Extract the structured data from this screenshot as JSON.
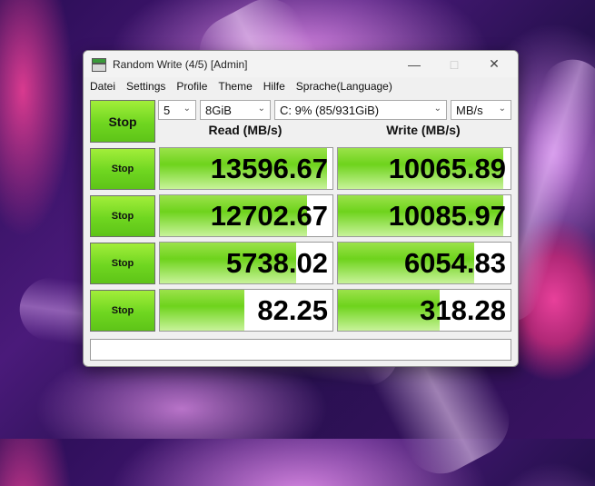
{
  "window": {
    "title": "Random Write (4/5) [Admin]",
    "accent": "#6fd620"
  },
  "menu": [
    "Datei",
    "Settings",
    "Profile",
    "Theme",
    "Hilfe",
    "Sprache(Language)"
  ],
  "controls": {
    "main_button": "Stop",
    "count": "5",
    "size": "8GiB",
    "drive": "C: 9% (85/931GiB)",
    "unit": "MB/s"
  },
  "headers": {
    "read": "Read (MB/s)",
    "write": "Write (MB/s)"
  },
  "rows": [
    {
      "button": "Stop",
      "read": "13596.67",
      "read_fill": 0.97,
      "write": "10065.89",
      "write_fill": 0.96
    },
    {
      "button": "Stop",
      "read": "12702.67",
      "read_fill": 0.85,
      "write": "10085.97",
      "write_fill": 0.96
    },
    {
      "button": "Stop",
      "read": "5738.02",
      "read_fill": 0.79,
      "write": "6054.83",
      "write_fill": 0.79
    },
    {
      "button": "Stop",
      "read": "82.25",
      "read_fill": 0.49,
      "write": "318.28",
      "write_fill": 0.59
    }
  ],
  "status": ""
}
